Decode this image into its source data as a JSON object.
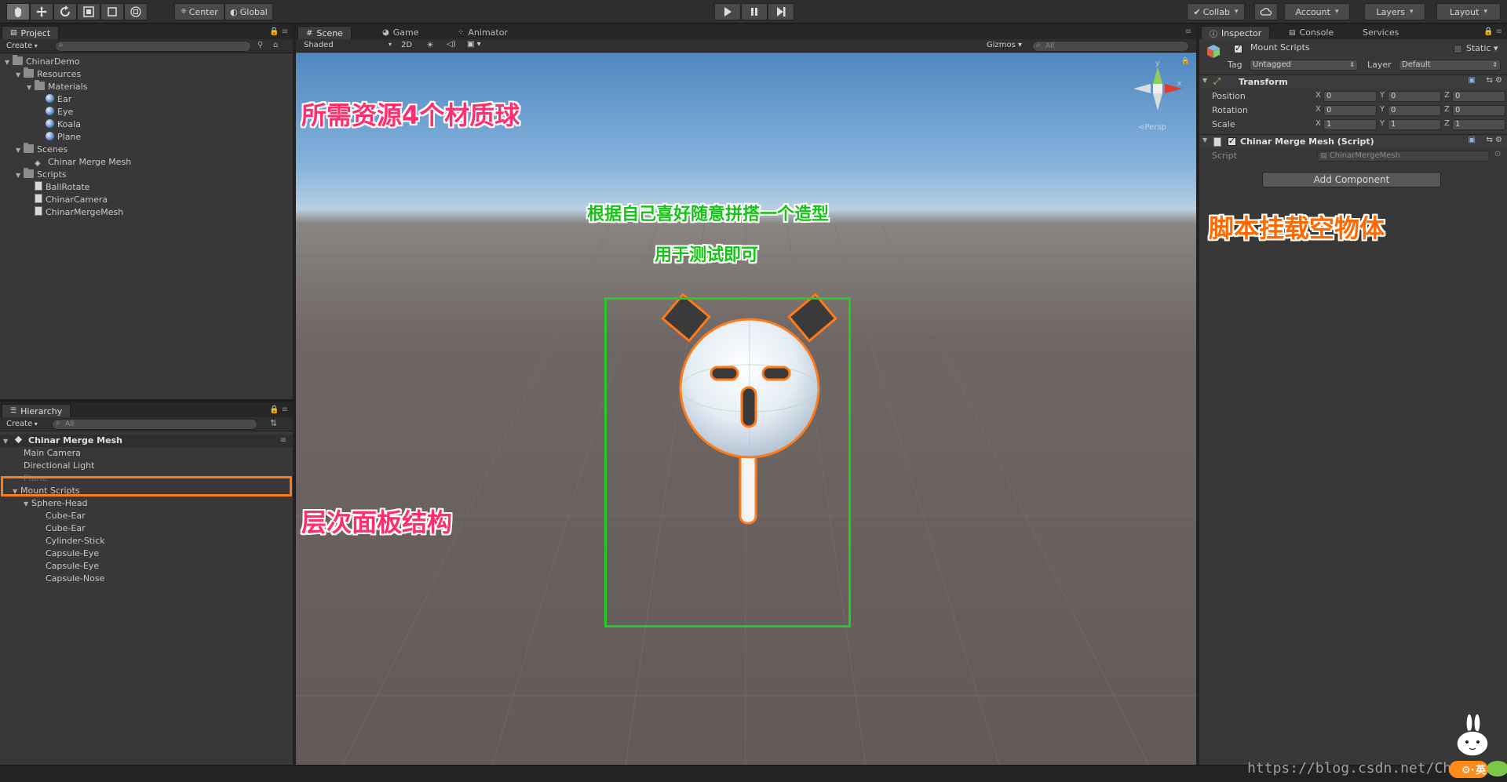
{
  "toolbar": {
    "pivot_center": "Center",
    "pivot_global": "Global",
    "collab": "Collab",
    "account": "Account",
    "layers": "Layers",
    "layout": "Layout"
  },
  "project": {
    "tab": "Project",
    "create": "Create",
    "items": [
      {
        "label": "ChinarDemo",
        "type": "folder",
        "depth": 0,
        "open": true
      },
      {
        "label": "Resources",
        "type": "folder",
        "depth": 1,
        "open": true
      },
      {
        "label": "Materials",
        "type": "folder",
        "depth": 2,
        "open": true
      },
      {
        "label": "Ear",
        "type": "material",
        "depth": 3
      },
      {
        "label": "Eye",
        "type": "material",
        "depth": 3
      },
      {
        "label": "Koala",
        "type": "material",
        "depth": 3
      },
      {
        "label": "Plane",
        "type": "material",
        "depth": 3
      },
      {
        "label": "Scenes",
        "type": "folder",
        "depth": 1,
        "open": true
      },
      {
        "label": "Chinar Merge Mesh",
        "type": "scene",
        "depth": 2
      },
      {
        "label": "Scripts",
        "type": "folder",
        "depth": 1,
        "open": true
      },
      {
        "label": "BallRotate",
        "type": "script",
        "depth": 2
      },
      {
        "label": "ChinarCamera",
        "type": "script",
        "depth": 2
      },
      {
        "label": "ChinarMergeMesh",
        "type": "script",
        "depth": 2
      }
    ]
  },
  "hierarchy": {
    "tab": "Hierarchy",
    "create": "Create",
    "search_placeholder": "All",
    "scene_name": "Chinar Merge Mesh",
    "items": [
      {
        "label": "Main Camera",
        "depth": 1
      },
      {
        "label": "Directional Light",
        "depth": 1
      },
      {
        "label": "Plane",
        "depth": 1,
        "faded": true
      },
      {
        "label": "Mount Scripts",
        "depth": 1,
        "open": true,
        "selected": true
      },
      {
        "label": "Sphere-Head",
        "depth": 2,
        "open": true
      },
      {
        "label": "Cube-Ear",
        "depth": 3
      },
      {
        "label": "Cube-Ear",
        "depth": 3
      },
      {
        "label": "Cylinder-Stick",
        "depth": 3
      },
      {
        "label": "Capsule-Eye",
        "depth": 3
      },
      {
        "label": "Capsule-Eye",
        "depth": 3
      },
      {
        "label": "Capsule-Nose",
        "depth": 3
      }
    ]
  },
  "scene": {
    "tabs": [
      "Scene",
      "Game",
      "Animator"
    ],
    "shading": "Shaded",
    "mode_2d": "2D",
    "gizmos": "Gizmos",
    "search_placeholder": "All",
    "persp": "Persp",
    "gizmo_y": "y",
    "gizmo_x": "x"
  },
  "inspector": {
    "tabs": [
      "Inspector",
      "Console",
      "Services"
    ],
    "object_name": "Mount Scripts",
    "static": "Static",
    "tag_label": "Tag",
    "tag_value": "Untagged",
    "layer_label": "Layer",
    "layer_value": "Default",
    "transform": "Transform",
    "position": "Position",
    "rotation": "Rotation",
    "scale": "Scale",
    "pos": [
      "0",
      "0",
      "0"
    ],
    "rot": [
      "0",
      "0",
      "0"
    ],
    "scl": [
      "1",
      "1",
      "1"
    ],
    "axis_x": "X",
    "axis_y": "Y",
    "axis_z": "Z",
    "component": "Chinar Merge Mesh (Script)",
    "script_label": "Script",
    "script_value": "ChinarMergeMesh",
    "add_component": "Add Component"
  },
  "annotations": {
    "materials": "所需资源4个材质球",
    "hierarchy": "层次面板结构",
    "script": "脚本挂载空物体",
    "model_line1": "根据自己喜好随意拼搭一个造型",
    "model_line2": "用于测试即可"
  },
  "watermark": "https://blog.csdn.net/Chi",
  "ime_label": "英",
  "colors": {
    "annotation_pink": "#ff2f6f",
    "annotation_orange": "#ff6a00",
    "annotation_green": "#15c415",
    "selection_outline": "#ff7a1a",
    "highlight_box": "#22cc22"
  }
}
